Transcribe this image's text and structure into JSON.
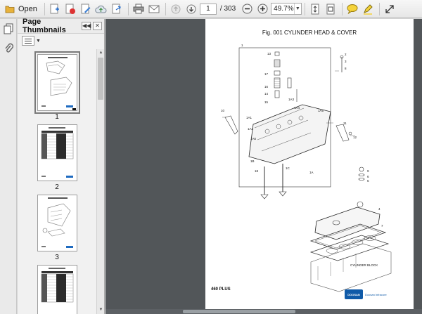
{
  "toolbar": {
    "open_label": "Open",
    "current_page": "1",
    "total_pages": "/ 303",
    "zoom": "49.7%"
  },
  "panel": {
    "title": "Page Thumbnails"
  },
  "thumbnails": [
    {
      "label": "1"
    },
    {
      "label": "2"
    },
    {
      "label": "3"
    }
  ],
  "document": {
    "figure_title": "Fig. 001 CYLINDER HEAD & COVER",
    "model": "460 PLUS",
    "brand_mark": "DOOSAN",
    "brand_text": "Doosan Infracore",
    "block_label": "CYLINDER BLOCK",
    "callouts": [
      "1",
      "2",
      "3",
      "4",
      "5",
      "6",
      "7",
      "8",
      "9",
      "10",
      "11",
      "12",
      "13",
      "14",
      "15",
      "16",
      "17",
      "18",
      "19",
      "1A",
      "1A1",
      "1A2",
      "1A3",
      "1A4",
      "1A5",
      "1A6",
      "1B",
      "1C"
    ]
  },
  "colors": {
    "viewport_bg": "#525659",
    "brand_blue": "#0f5aa8"
  }
}
